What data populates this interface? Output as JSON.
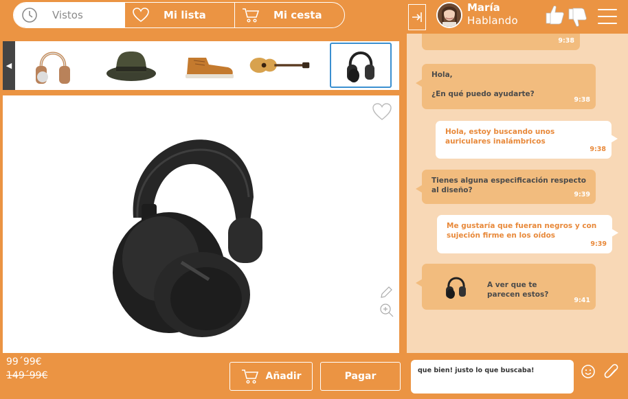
{
  "nav": {
    "tabs": [
      {
        "label": "Vistos",
        "icon": "clock-icon",
        "active": true
      },
      {
        "label": "Mi lista",
        "icon": "heart-icon",
        "active": false
      },
      {
        "label": "Mi cesta",
        "icon": "cart-icon",
        "active": false
      }
    ]
  },
  "agent": {
    "name": "María",
    "status": "Hablando"
  },
  "carousel": {
    "items": [
      "headphones-silver",
      "fedora-hat",
      "leather-boot",
      "acoustic-guitar",
      "headphones-black"
    ],
    "selected_index": 4
  },
  "product": {
    "image": "black-headphones",
    "price": "99´99€",
    "old_price": "149´99€"
  },
  "actions": {
    "add_label": "Añadir",
    "pay_label": "Pagar"
  },
  "chat": {
    "messages": [
      {
        "from": "agent",
        "text": "",
        "time": "9:38"
      },
      {
        "from": "agent",
        "lines": [
          "Hola,",
          "¿En qué puedo ayudarte?"
        ],
        "time": "9:38"
      },
      {
        "from": "user",
        "text": "Hola, estoy buscando unos auriculares inalámbricos",
        "time": "9:38"
      },
      {
        "from": "agent",
        "text": "Tienes alguna especificación respecto al diseño?",
        "time": "9:39"
      },
      {
        "from": "user",
        "text": "Me gustaría que fueran negros y con sujeción firme en los oídos",
        "time": "9:39"
      },
      {
        "from": "agent",
        "text": "A ver que te parecen estos?",
        "time": "9:41",
        "attachment": "black-headphones"
      }
    ],
    "composer_text": "que bien! justo lo que buscaba!"
  },
  "colors": {
    "accent": "#EB9443",
    "chat_bg": "#F8D8B6",
    "agent_bubble": "#F2BC7E",
    "selected_border": "#3a8fd0"
  }
}
